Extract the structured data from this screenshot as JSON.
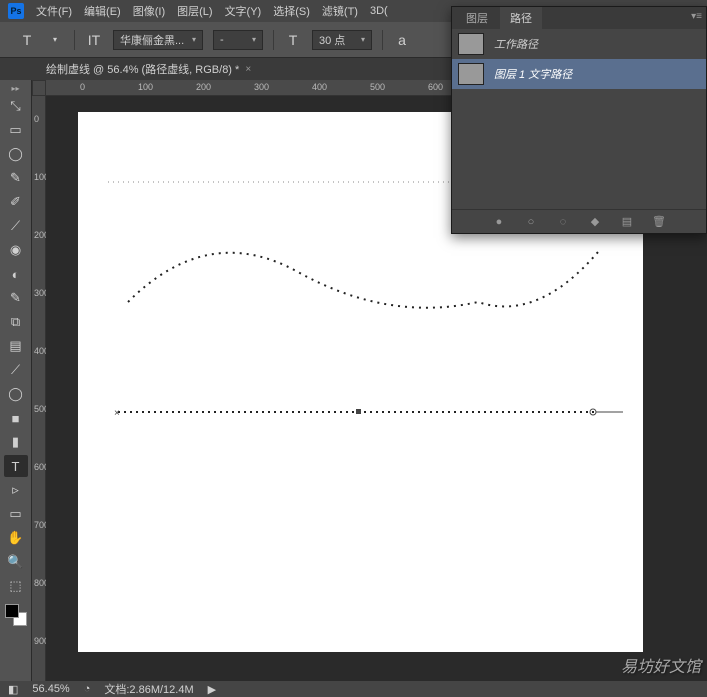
{
  "app": {
    "logo": "Ps"
  },
  "menu": {
    "file": "文件(F)",
    "edit": "编辑(E)",
    "image": "图像(I)",
    "layer": "图层(L)",
    "type": "文字(Y)",
    "select": "选择(S)",
    "filter": "滤镜(T)",
    "threed": "3D("
  },
  "options": {
    "toggle": "T",
    "orient": "IT",
    "font_family": "华康俪金黑...",
    "font_style": "-",
    "size_icon": "T",
    "size_value": "30 点",
    "aa_label": "a"
  },
  "doc": {
    "title": "绘制虚线 @ 56.4% (路径虚线, RGB/8) *",
    "close": "×"
  },
  "ruler_h": [
    "0",
    "100",
    "200",
    "300",
    "400",
    "500",
    "600"
  ],
  "ruler_v": [
    "0",
    "100",
    "200",
    "300",
    "400",
    "500",
    "600",
    "700",
    "800",
    "900"
  ],
  "paths_panel": {
    "tab_layers": "图层",
    "tab_paths": "路径",
    "rows": [
      {
        "name": "工作路径"
      },
      {
        "name": "图层 1 文字路径"
      }
    ]
  },
  "status": {
    "nav_icon": "◧",
    "zoom": "56.45%",
    "timeline_icon": "◔",
    "doc_info": "文档:2.86M/12.4M",
    "arrow": "▶"
  },
  "watermark": "易坊好文馆",
  "tool_icons": [
    "⤡",
    "▭",
    "◯",
    "✎",
    "✐",
    "⟋",
    "◉",
    "◐",
    "✎",
    "⧉",
    "▤",
    "⟋",
    "◯",
    "■",
    "▮",
    "○",
    "◍",
    "✎",
    "T",
    "▹",
    "▭",
    "✋",
    "🔍",
    "⬚"
  ]
}
